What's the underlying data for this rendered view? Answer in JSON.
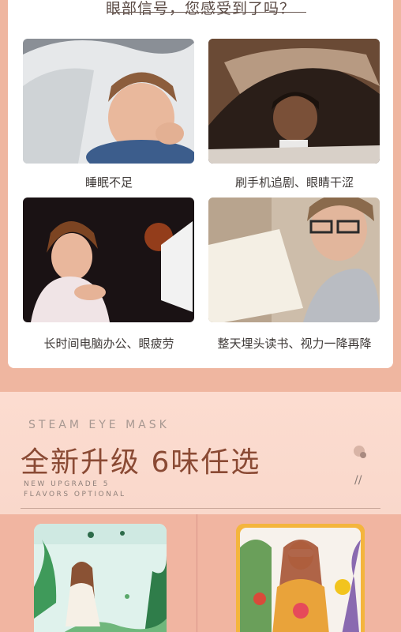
{
  "top": {
    "heading": "眼部信号，您感受到了吗？"
  },
  "cards": [
    {
      "icon": "tired-child-under-blanket-photo",
      "caption": "睡眠不足"
    },
    {
      "icon": "child-phone-under-blanket-photo",
      "caption": "刷手机追剧、眼睛干涩"
    },
    {
      "icon": "woman-at-computer-photo",
      "caption": "长时间电脑办公、眼疲劳"
    },
    {
      "icon": "boy-reading-book-photo",
      "caption": "整天埋头读书、视力一降再降"
    }
  ],
  "steam": {
    "label_en": "STEAM EYE MASK",
    "title": "全新升级  6味任选",
    "sub_line1": "NEW UPGRADE 5",
    "sub_line2": "FLAVORS OPTIONAL"
  },
  "products": [
    {
      "icon": "green-mask-package-image"
    },
    {
      "icon": "yellow-mask-package-image"
    }
  ],
  "colors": {
    "background": "#efb6a0",
    "card": "#ffffff",
    "title": "#8a4a34",
    "section": "#fcdcd0"
  }
}
